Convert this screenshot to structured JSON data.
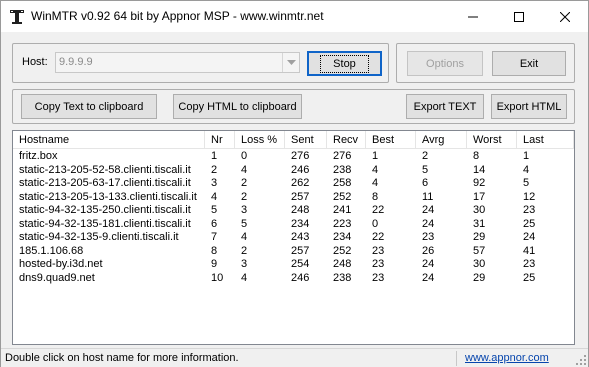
{
  "window": {
    "title": "WinMTR v0.92 64 bit by Appnor MSP - www.winmtr.net"
  },
  "titlebar": {
    "icons": [
      "app-icon",
      "minimize-icon",
      "maximize-icon",
      "close-icon"
    ]
  },
  "host": {
    "label": "Host:",
    "value": "9.9.9.9"
  },
  "buttons": {
    "stop": "Stop",
    "options": "Options",
    "exit": "Exit",
    "copy_text": "Copy Text to clipboard",
    "copy_html": "Copy HTML to clipboard",
    "export_text": "Export TEXT",
    "export_html": "Export HTML"
  },
  "table": {
    "columns": [
      "Hostname",
      "Nr",
      "Loss %",
      "Sent",
      "Recv",
      "Best",
      "Avrg",
      "Worst",
      "Last"
    ],
    "rows": [
      [
        "fritz.box",
        "1",
        "0",
        "276",
        "276",
        "1",
        "2",
        "8",
        "1"
      ],
      [
        "static-213-205-52-58.clienti.tiscali.it",
        "2",
        "4",
        "246",
        "238",
        "4",
        "5",
        "14",
        "4"
      ],
      [
        "static-213-205-63-17.clienti.tiscali.it",
        "3",
        "2",
        "262",
        "258",
        "4",
        "6",
        "92",
        "5"
      ],
      [
        "static-213-205-13-133.clienti.tiscali.it",
        "4",
        "2",
        "257",
        "252",
        "8",
        "11",
        "17",
        "12"
      ],
      [
        "static-94-32-135-250.clienti.tiscali.it",
        "5",
        "3",
        "248",
        "241",
        "22",
        "24",
        "30",
        "23"
      ],
      [
        "static-94-32-135-181.clienti.tiscali.it",
        "6",
        "5",
        "234",
        "223",
        "0",
        "24",
        "31",
        "25"
      ],
      [
        "static-94-32-135-9.clienti.tiscali.it",
        "7",
        "4",
        "243",
        "234",
        "22",
        "23",
        "29",
        "24"
      ],
      [
        "185.1.106.68",
        "8",
        "2",
        "257",
        "252",
        "23",
        "26",
        "57",
        "41"
      ],
      [
        "hosted-by.i3d.net",
        "9",
        "3",
        "254",
        "248",
        "23",
        "24",
        "30",
        "23"
      ],
      [
        "dns9.quad9.net",
        "10",
        "4",
        "246",
        "238",
        "23",
        "24",
        "29",
        "25"
      ]
    ]
  },
  "status": {
    "text": "Double click on host name for more information.",
    "link": "www.appnor.com"
  },
  "colors": {
    "accent": "#0f64c8",
    "link": "#0645ad",
    "disabled_text": "#a0a0a0"
  }
}
